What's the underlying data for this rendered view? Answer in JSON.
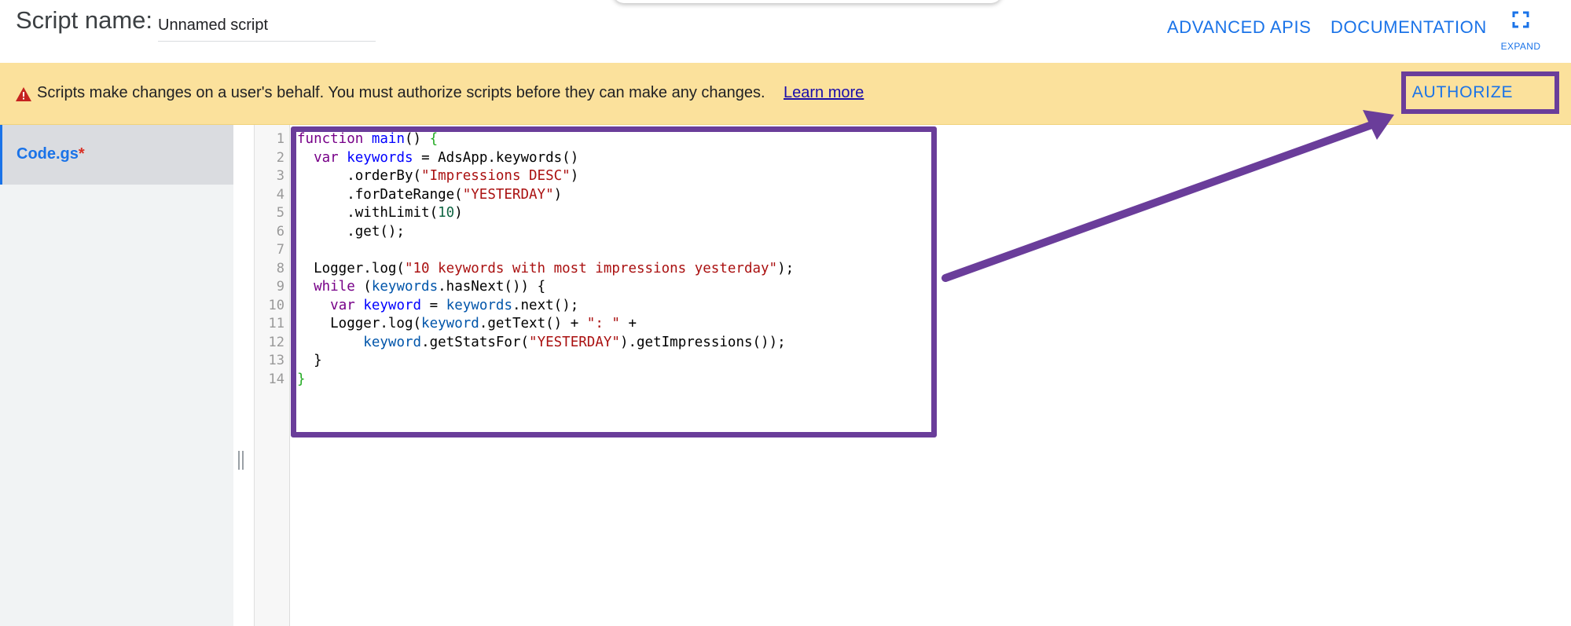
{
  "header": {
    "script_name_label": "Script name:",
    "script_name_value": "Unnamed script",
    "advanced_apis": "ADVANCED APIS",
    "documentation": "DOCUMENTATION",
    "expand_label": "EXPAND",
    "expand_icon": "expand-icon"
  },
  "banner": {
    "message": "Scripts make changes on a user's behalf. You must authorize scripts before they can make any changes.",
    "learn_more": "Learn more",
    "authorize": "AUTHORIZE",
    "warning_icon": "warning-icon",
    "background_color": "#fbe19c"
  },
  "sidebar": {
    "files": [
      {
        "name": "Code.gs",
        "modified_marker": "*"
      }
    ]
  },
  "editor": {
    "line_numbers": [
      "1",
      "2",
      "3",
      "4",
      "5",
      "6",
      "7",
      "8",
      "9",
      "10",
      "11",
      "12",
      "13",
      "14"
    ],
    "code_lines": [
      "function main() {",
      "  var keywords = AdsApp.keywords()",
      "      .orderBy(\"Impressions DESC\")",
      "      .forDateRange(\"YESTERDAY\")",
      "      .withLimit(10)",
      "      .get();",
      "",
      "  Logger.log(\"10 keywords with most impressions yesterday\");",
      "  while (keywords.hasNext()) {",
      "    var keyword = keywords.next();",
      "    Logger.log(keyword.getText() + \": \" +",
      "        keyword.getStatsFor(\"YESTERDAY\").getImpressions());",
      "  }",
      "}"
    ]
  },
  "colors": {
    "accent": "#1a73e8",
    "annotation": "#6a3d9a",
    "modified": "#d93025"
  }
}
